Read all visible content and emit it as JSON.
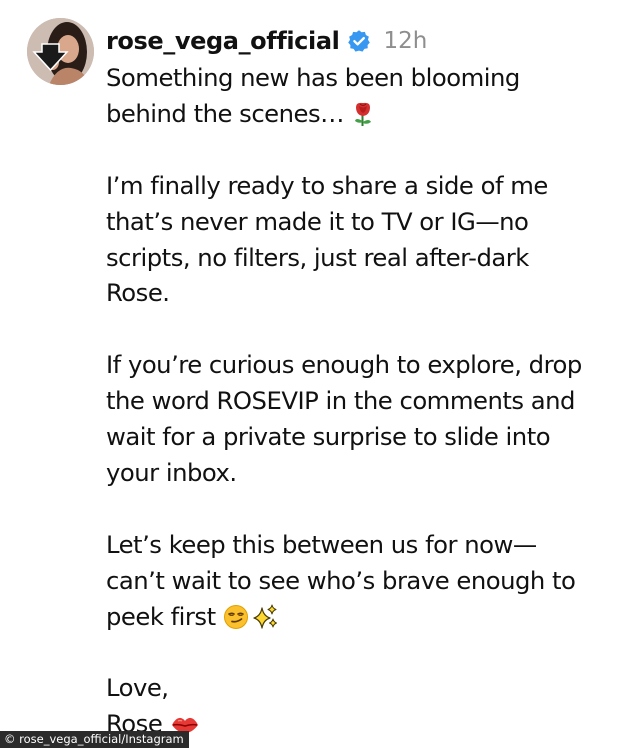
{
  "post": {
    "username": "rose_vega_official",
    "time": "12h",
    "verified_color": "#3897f0",
    "avatar_icon": "profile-photo",
    "caption": {
      "p1": "Something new has been blooming\nbehind the scenes…",
      "p1_emoji": "rose-emoji",
      "p2": "I’m finally ready to share a side of me\nthat’s never made it to TV or IG—no\nscripts, no filters, just real after-dark\nRose.",
      "p3": "If you’re curious enough to explore, drop\nthe word ROSEVIP in the comments and\nwait for a private surprise to slide into\nyour inbox.",
      "p4": "Let’s keep this between us for now—\ncan’t wait to see who’s brave enough to\npeek first",
      "p4_emojis": [
        "smirk-emoji",
        "sparkles-emoji"
      ],
      "p5_line1": "Love,",
      "p5_line2": "Rose",
      "p5_emoji": "kiss-lips-emoji"
    }
  },
  "credit": "© rose_vega_official/Instagram"
}
